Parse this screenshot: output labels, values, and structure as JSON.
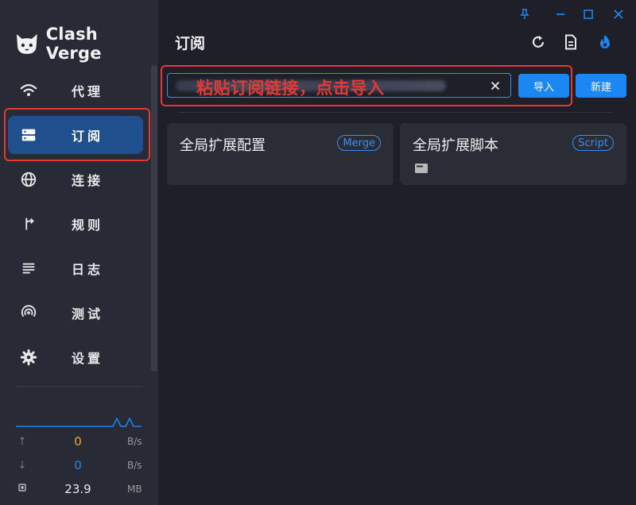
{
  "app": {
    "name": "Clash Verge"
  },
  "nav": {
    "items": [
      {
        "label": "代理",
        "icon": "wifi-icon"
      },
      {
        "label": "订阅",
        "icon": "server-icon",
        "active": true
      },
      {
        "label": "连接",
        "icon": "globe-icon"
      },
      {
        "label": "规则",
        "icon": "fork-arrow-icon"
      },
      {
        "label": "日志",
        "icon": "lines-icon"
      },
      {
        "label": "测试",
        "icon": "radar-icon"
      },
      {
        "label": "设置",
        "icon": "gear-icon"
      }
    ]
  },
  "stats": {
    "upload": {
      "value": "0",
      "unit": "B/s",
      "color": "#f5a623"
    },
    "download": {
      "value": "0",
      "unit": "B/s",
      "color": "#1c86f2"
    },
    "memory": {
      "value": "23.9",
      "unit": "MB"
    }
  },
  "header": {
    "title": "订阅"
  },
  "import": {
    "placeholder": "粘贴订阅链接，点击导入",
    "import_label": "导入",
    "new_label": "新建"
  },
  "cards": [
    {
      "title": "全局扩展配置",
      "badge": "Merge"
    },
    {
      "title": "全局扩展脚本",
      "badge": "Script"
    }
  ],
  "colors": {
    "accent": "#1c86f2",
    "annotation": "#e53935",
    "sidebar_active": "#1f4f8c"
  }
}
